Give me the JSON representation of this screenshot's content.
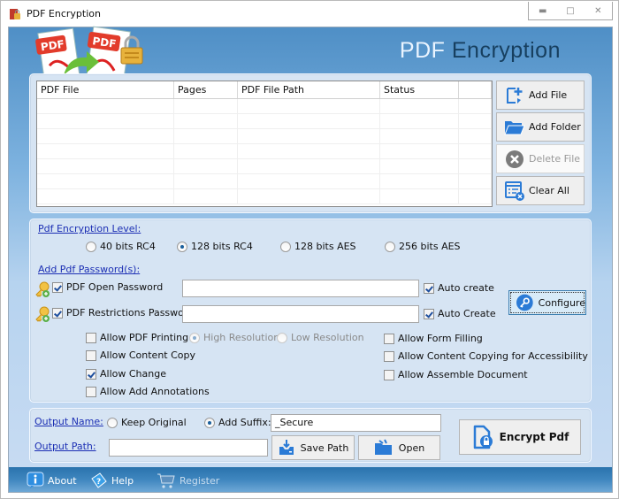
{
  "window": {
    "title": "PDF Encryption",
    "controls": {
      "minimize": "minimize-icon",
      "maximize": "maximize-icon",
      "close": "close-icon"
    }
  },
  "header": {
    "title_part1": "PDF",
    "title_part2": "Encryption"
  },
  "file_table": {
    "columns": [
      "PDF File",
      "Pages",
      "PDF File Path",
      "Status",
      ""
    ],
    "rows": []
  },
  "file_buttons": {
    "add_file": "Add File",
    "add_folder": "Add Folder",
    "delete_file": "Delete File",
    "clear_all": "Clear All"
  },
  "encryption": {
    "level_label": "Pdf Encryption Level:",
    "levels": [
      {
        "label": "40 bits RC4",
        "selected": false
      },
      {
        "label": "128 bits RC4",
        "selected": true
      },
      {
        "label": "128 bits AES",
        "selected": false
      },
      {
        "label": "256 bits AES",
        "selected": false
      }
    ],
    "password_label": "Add Pdf Password(s):",
    "open_password": {
      "label": "PDF Open Password",
      "checked": true,
      "value": "",
      "auto_label": "Auto create",
      "auto_checked": true
    },
    "restrictions_password": {
      "label": "PDF Restrictions Password",
      "checked": true,
      "value": "",
      "auto_label": "Auto Create",
      "auto_checked": true
    },
    "configure_label": "Configure",
    "permissions_left": [
      {
        "label": "Allow PDF Printing",
        "checked": false
      },
      {
        "label": "Allow Content Copy",
        "checked": false
      },
      {
        "label": "Allow Change",
        "checked": true
      },
      {
        "label": "Allow Add Annotations",
        "checked": false
      }
    ],
    "print_resolution": [
      {
        "label": "High Resolution",
        "selected": true,
        "disabled": true
      },
      {
        "label": "Low Resolution",
        "selected": false,
        "disabled": true
      }
    ],
    "permissions_right": [
      {
        "label": "Allow Form Filling",
        "checked": false
      },
      {
        "label": "Allow Content Copying for Accessibility",
        "checked": false
      },
      {
        "label": "Allow Assemble Document",
        "checked": false
      }
    ]
  },
  "output": {
    "name_label": "Output Name:",
    "keep_original": "Keep Original",
    "keep_original_selected": false,
    "add_suffix": "Add Suffix:",
    "add_suffix_selected": true,
    "suffix_value": "_Secure",
    "path_label": "Output Path:",
    "path_value": "",
    "save_path": "Save Path",
    "open": "Open",
    "encrypt": "Encrypt Pdf"
  },
  "footer": {
    "about": "About",
    "help": "Help",
    "register": "Register"
  },
  "colors": {
    "link": "#1c2fb4",
    "accent_blue": "#2a73ad",
    "header_dark": "#173f5f"
  }
}
